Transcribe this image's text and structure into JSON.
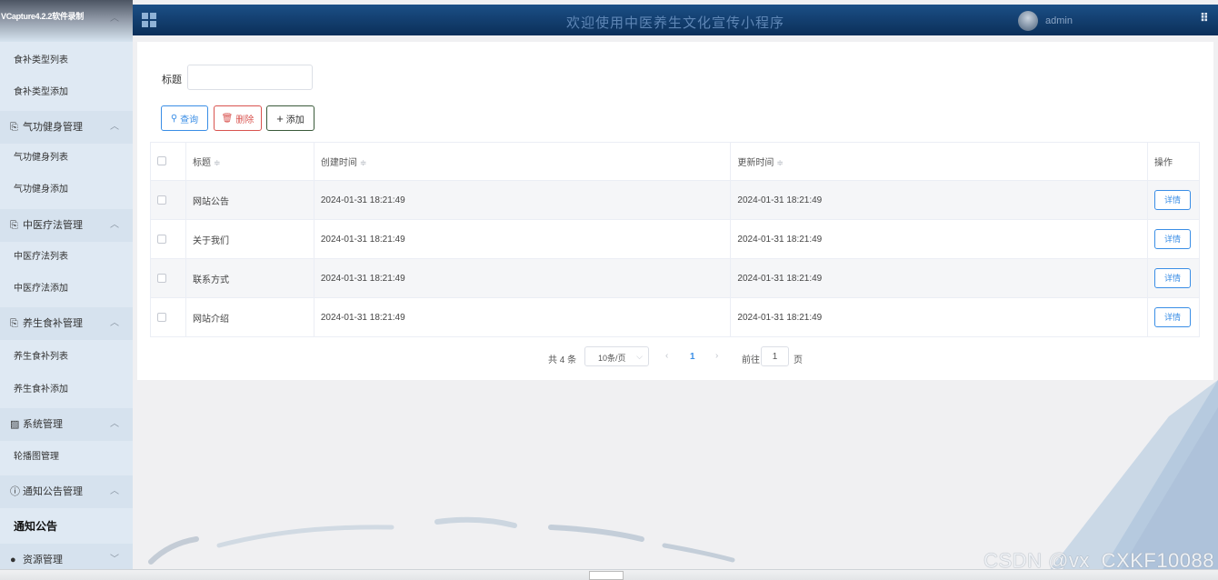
{
  "recorder": {
    "label": "VCapture4.2.2软件录制"
  },
  "header": {
    "title": "欢迎使用中医养生文化宣传小程序",
    "user": "admin"
  },
  "sidebar": {
    "items": [
      {
        "kind": "sub",
        "label": "食补类型列表"
      },
      {
        "kind": "sub",
        "label": "食补类型添加"
      },
      {
        "kind": "group",
        "label": "气功健身管理"
      },
      {
        "kind": "sub",
        "label": "气功健身列表"
      },
      {
        "kind": "sub",
        "label": "气功健身添加"
      },
      {
        "kind": "group",
        "label": "中医疗法管理"
      },
      {
        "kind": "sub",
        "label": "中医疗法列表"
      },
      {
        "kind": "sub",
        "label": "中医疗法添加"
      },
      {
        "kind": "group",
        "label": "养生食补管理"
      },
      {
        "kind": "sub",
        "label": "养生食补列表"
      },
      {
        "kind": "sub",
        "label": "养生食补添加"
      },
      {
        "kind": "group",
        "label": "系统管理"
      },
      {
        "kind": "sub",
        "label": "轮播图管理"
      },
      {
        "kind": "group",
        "label": "通知公告管理"
      },
      {
        "kind": "active",
        "label": "通知公告"
      },
      {
        "kind": "group",
        "label": "资源管理"
      }
    ]
  },
  "search": {
    "label": "标题",
    "value": ""
  },
  "toolbar": {
    "search": "查询",
    "delete": "删除",
    "add": "添加"
  },
  "table": {
    "headers": [
      "标题",
      "创建时间",
      "更新时间",
      "操作"
    ],
    "rows": [
      {
        "title": "网站公告",
        "created": "2024-01-31 18:21:49",
        "updated": "2024-01-31 18:21:49"
      },
      {
        "title": "关于我们",
        "created": "2024-01-31 18:21:49",
        "updated": "2024-01-31 18:21:49"
      },
      {
        "title": "联系方式",
        "created": "2024-01-31 18:21:49",
        "updated": "2024-01-31 18:21:49"
      },
      {
        "title": "网站介绍",
        "created": "2024-01-31 18:21:49",
        "updated": "2024-01-31 18:21:49"
      }
    ],
    "detail_label": "详情"
  },
  "pagination": {
    "total": "共 4 条",
    "page_size": "10条/页",
    "current": "1",
    "goto_label": "前往",
    "goto_value": "1",
    "page_unit": "页"
  },
  "watermark": "CSDN @vx_CXKF10088"
}
